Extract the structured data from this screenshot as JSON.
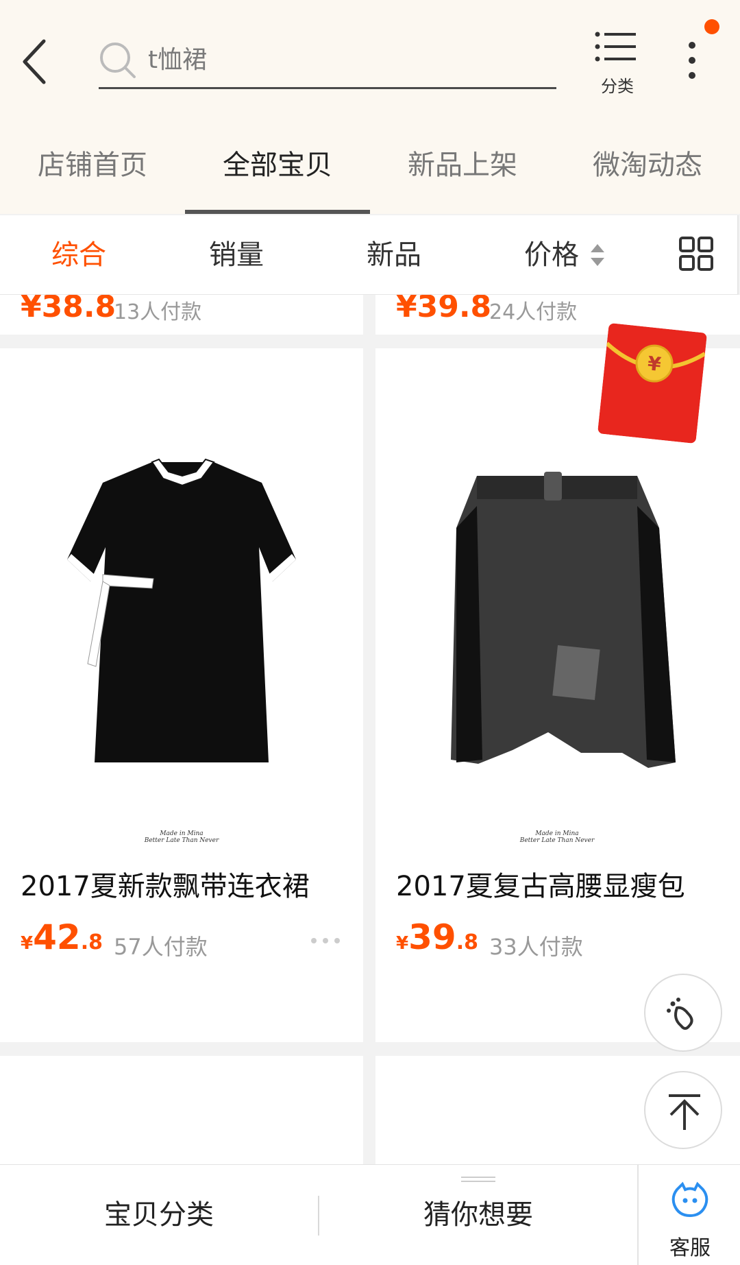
{
  "header": {
    "search_text": "t恤裙",
    "category_label": "分类"
  },
  "tabs": [
    {
      "label": "店铺首页"
    },
    {
      "label": "全部宝贝"
    },
    {
      "label": "新品上架"
    },
    {
      "label": "微淘动态"
    }
  ],
  "sort": [
    {
      "label": "综合"
    },
    {
      "label": "销量"
    },
    {
      "label": "新品"
    },
    {
      "label": "价格"
    }
  ],
  "partial_row": [
    {
      "price": "¥38.8",
      "sales": "13人付款"
    },
    {
      "price": "¥39.8",
      "sales": "24人付款"
    }
  ],
  "products": [
    {
      "title": "2017夏新款飘带连衣裙",
      "currency": "¥",
      "price_int": "42",
      "price_dec": ".8",
      "sales": "57人付款"
    },
    {
      "title": "2017夏复古高腰显瘦包",
      "currency": "¥",
      "price_int": "39",
      "price_dec": ".8",
      "sales": "33人付款"
    }
  ],
  "bottom_bar": {
    "categories": "宝贝分类",
    "guess": "猜你想要",
    "service": "客服"
  },
  "colors": {
    "accent": "#ff5000",
    "header_bg": "#fcf8f1",
    "redpacket": "#e8261e"
  }
}
